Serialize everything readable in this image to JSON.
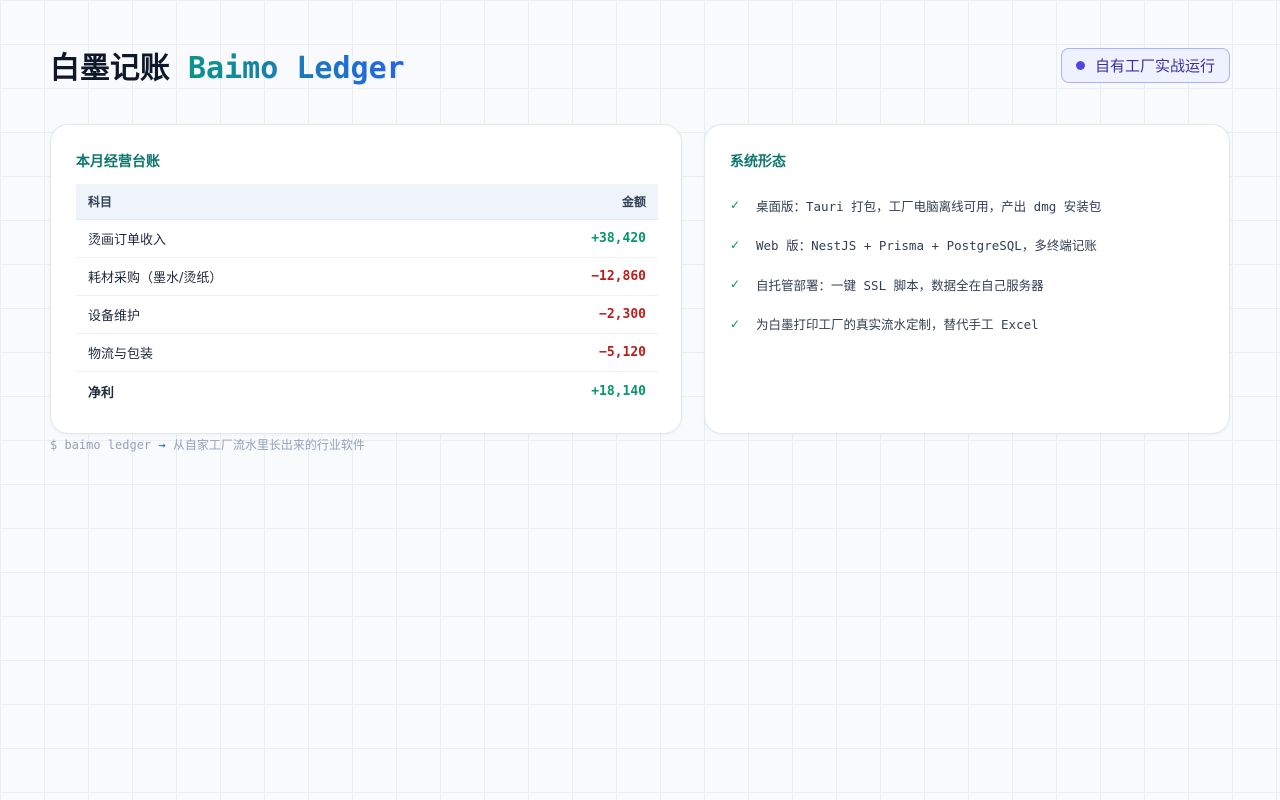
{
  "header": {
    "title_cn": "白墨记账",
    "title_en": "Baimo Ledger",
    "badge": "自有工厂实战运行"
  },
  "ledger": {
    "title": "本月经营台账",
    "col_item": "科目",
    "col_amount": "金额",
    "rows": [
      {
        "label": "烫画订单收入",
        "amount": "+38,420"
      },
      {
        "label": "耗材采购（墨水/烫纸）",
        "amount": "−12,860"
      },
      {
        "label": "设备维护",
        "amount": "−2,300"
      },
      {
        "label": "物流与包装",
        "amount": "−5,120"
      },
      {
        "label": "净利",
        "amount": "+18,140"
      }
    ]
  },
  "system": {
    "title": "系统形态",
    "features": [
      "桌面版：Tauri 打包，工厂电脑离线可用，产出 dmg 安装包",
      "Web 版：NestJS + Prisma + PostgreSQL，多终端记账",
      "自托管部署：一键 SSL 脚本，数据全在自己服务器",
      "为白墨打印工厂的真实流水定制，替代手工 Excel"
    ]
  },
  "footer": {
    "cmd": "$ baimo ledger",
    "arrow": "→",
    "text": "从自家工厂流水里长出来的行业软件"
  },
  "colors": {
    "positive": "#059669",
    "negative": "#b91c1c",
    "accent": "#0f766e"
  }
}
